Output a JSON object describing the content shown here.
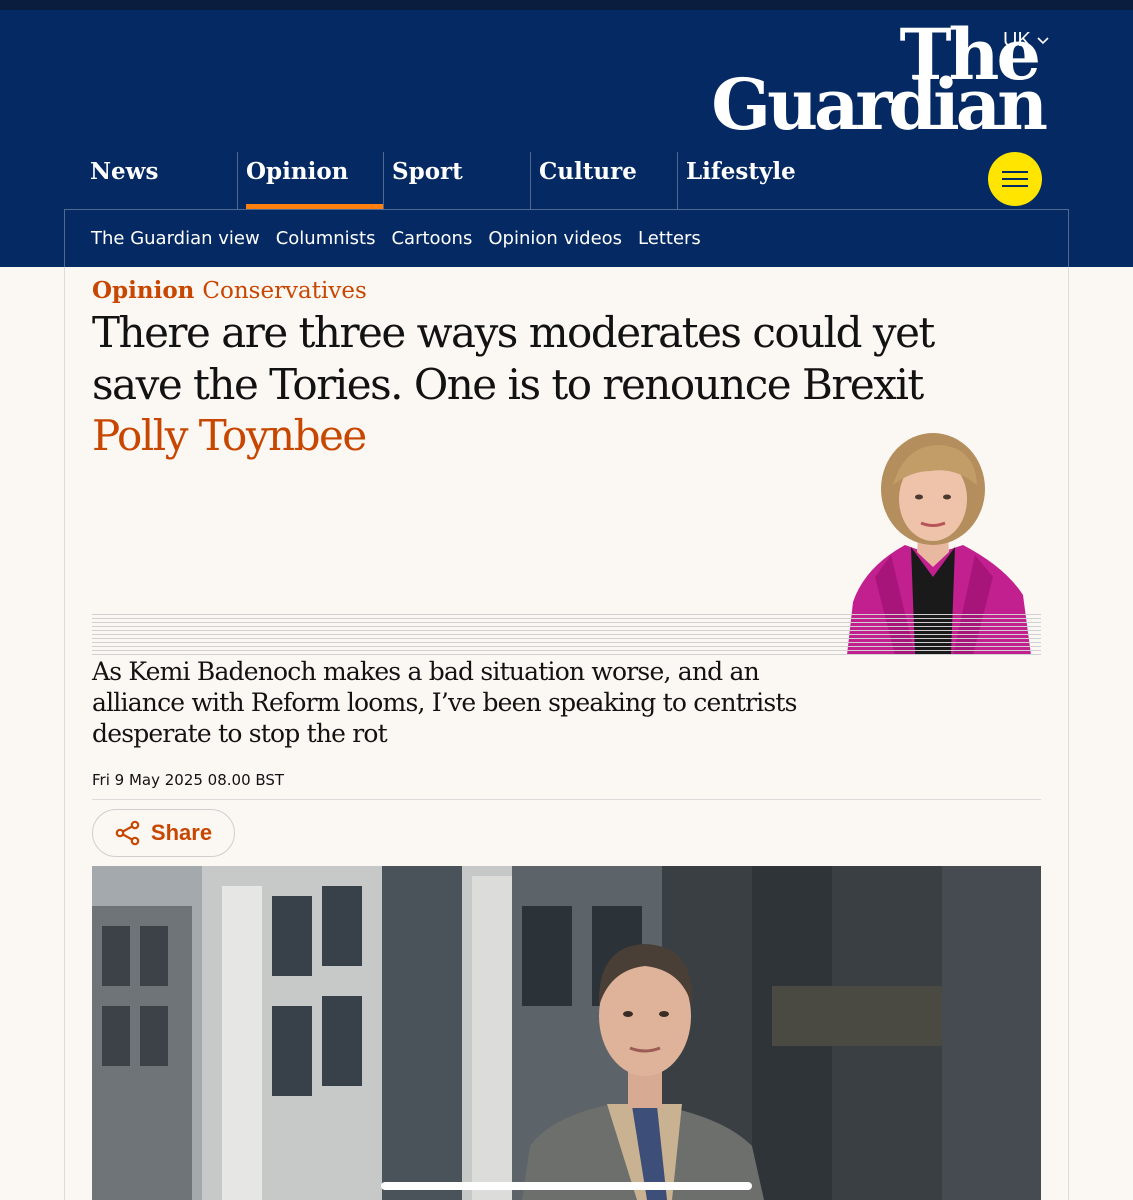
{
  "header": {
    "edition": "UK",
    "logo_line1": "The",
    "logo_line2": "Guardian",
    "pillars": [
      {
        "label": "News"
      },
      {
        "label": "Opinion",
        "active": true
      },
      {
        "label": "Sport"
      },
      {
        "label": "Culture"
      },
      {
        "label": "Lifestyle"
      }
    ],
    "subnav": [
      "The Guardian view",
      "Columnists",
      "Cartoons",
      "Opinion videos",
      "Letters"
    ]
  },
  "article": {
    "pillar": "Opinion",
    "section": "Conservatives",
    "headline": "There are three ways moderates could yet save the Tories. One is to renounce Brexit",
    "byline": "Polly Toynbee",
    "standfirst": "As Kemi Badenoch makes a bad situation worse, and an alliance with Reform looms, I’ve been speaking to centrists desperate to stop the rot",
    "dateline": "Fri 9 May 2025 08.00 BST",
    "share_label": "Share"
  },
  "icons": {
    "menu": "hamburger-menu-icon",
    "share": "share-icon",
    "edition": "chevron-down-icon"
  },
  "colors": {
    "brand_blue": "#052962",
    "opinion_orange": "#c74600",
    "highlight_orange": "#ff7f0f",
    "menu_yellow": "#ffe500",
    "page_bg": "#fbf7f3"
  }
}
